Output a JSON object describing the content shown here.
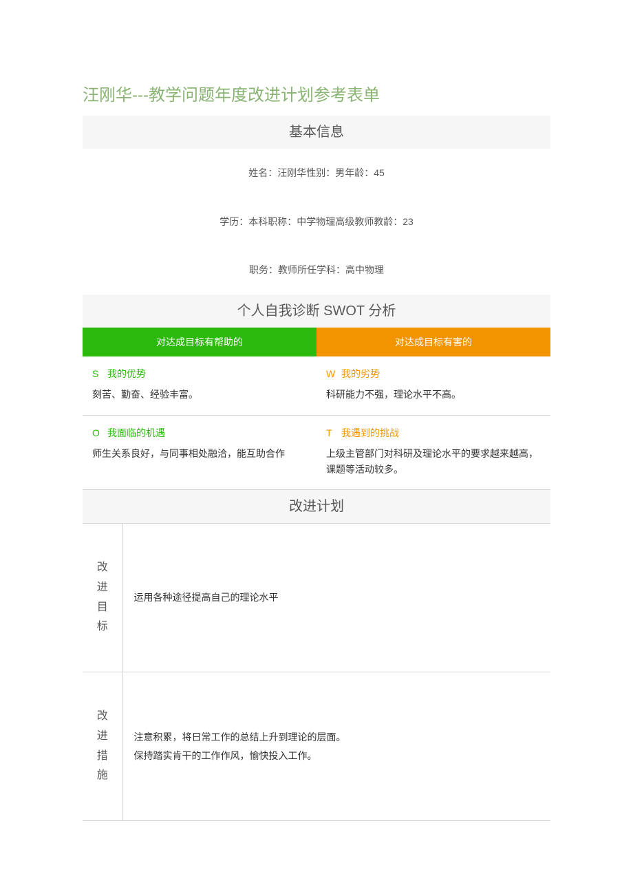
{
  "title": "汪刚华---教学问题年度改进计划参考表单",
  "sections": {
    "basic_info_header": "基本信息",
    "swot_header": "个人自我诊断 SWOT 分析",
    "plan_header": "改进计划"
  },
  "basic_info": {
    "row1": "姓名：汪刚华性别：男年龄：45",
    "row2": "学历：本科职称：中学物理高级教师教龄：23",
    "row3": "职务：教师所任学科：高中物理"
  },
  "swot": {
    "helpful_header": "对达成目标有帮助的",
    "harmful_header": "对达成目标有害的",
    "s": {
      "letter": "S",
      "label": "我的优势",
      "content": "刻苦、勤奋、经验丰富。"
    },
    "w": {
      "letter": "W",
      "label": "我的劣势",
      "content": "科研能力不强，理论水平不高。"
    },
    "o": {
      "letter": "O",
      "label": "我面临的机遇",
      "content": "师生关系良好，与同事相处融洽，能互助合作"
    },
    "t": {
      "letter": "T",
      "label": "我遇到的挑战",
      "content": "上级主管部门对科研及理论水平的要求越来越高，课题等活动较多。"
    }
  },
  "plan": {
    "goal_label_1": "改",
    "goal_label_2": "进",
    "goal_label_3": "目",
    "goal_label_4": "标",
    "goal_content": "运用各种途径提高自己的理论水平",
    "measure_label_1": "改",
    "measure_label_2": "进",
    "measure_label_3": "措",
    "measure_label_4": "施",
    "measure_content_1": "注意积累，将日常工作的总结上升到理论的层面。",
    "measure_content_2": "保持踏实肯干的工作作风，愉快投入工作。"
  }
}
